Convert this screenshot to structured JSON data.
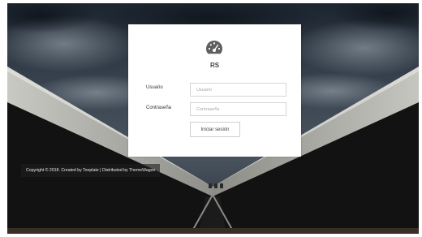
{
  "login": {
    "brand": "RS",
    "username_label": "Usuario",
    "username_placeholder": "Usuario",
    "password_label": "Contraseña",
    "password_placeholder": "Contraseña",
    "submit_label": "Iniciar sesión"
  },
  "footer": {
    "copyright": "Copyright © 2018. Created by Tooplate",
    "separator": "|",
    "distributed": "Distributed by ThemeWagon"
  },
  "icons": {
    "logo": "tachometer-icon"
  },
  "colors": {
    "card_background": "#ffffff",
    "logo": "#5f5f5f",
    "field_border": "#d5d5d5",
    "footer_background": "#1e1e1e"
  }
}
